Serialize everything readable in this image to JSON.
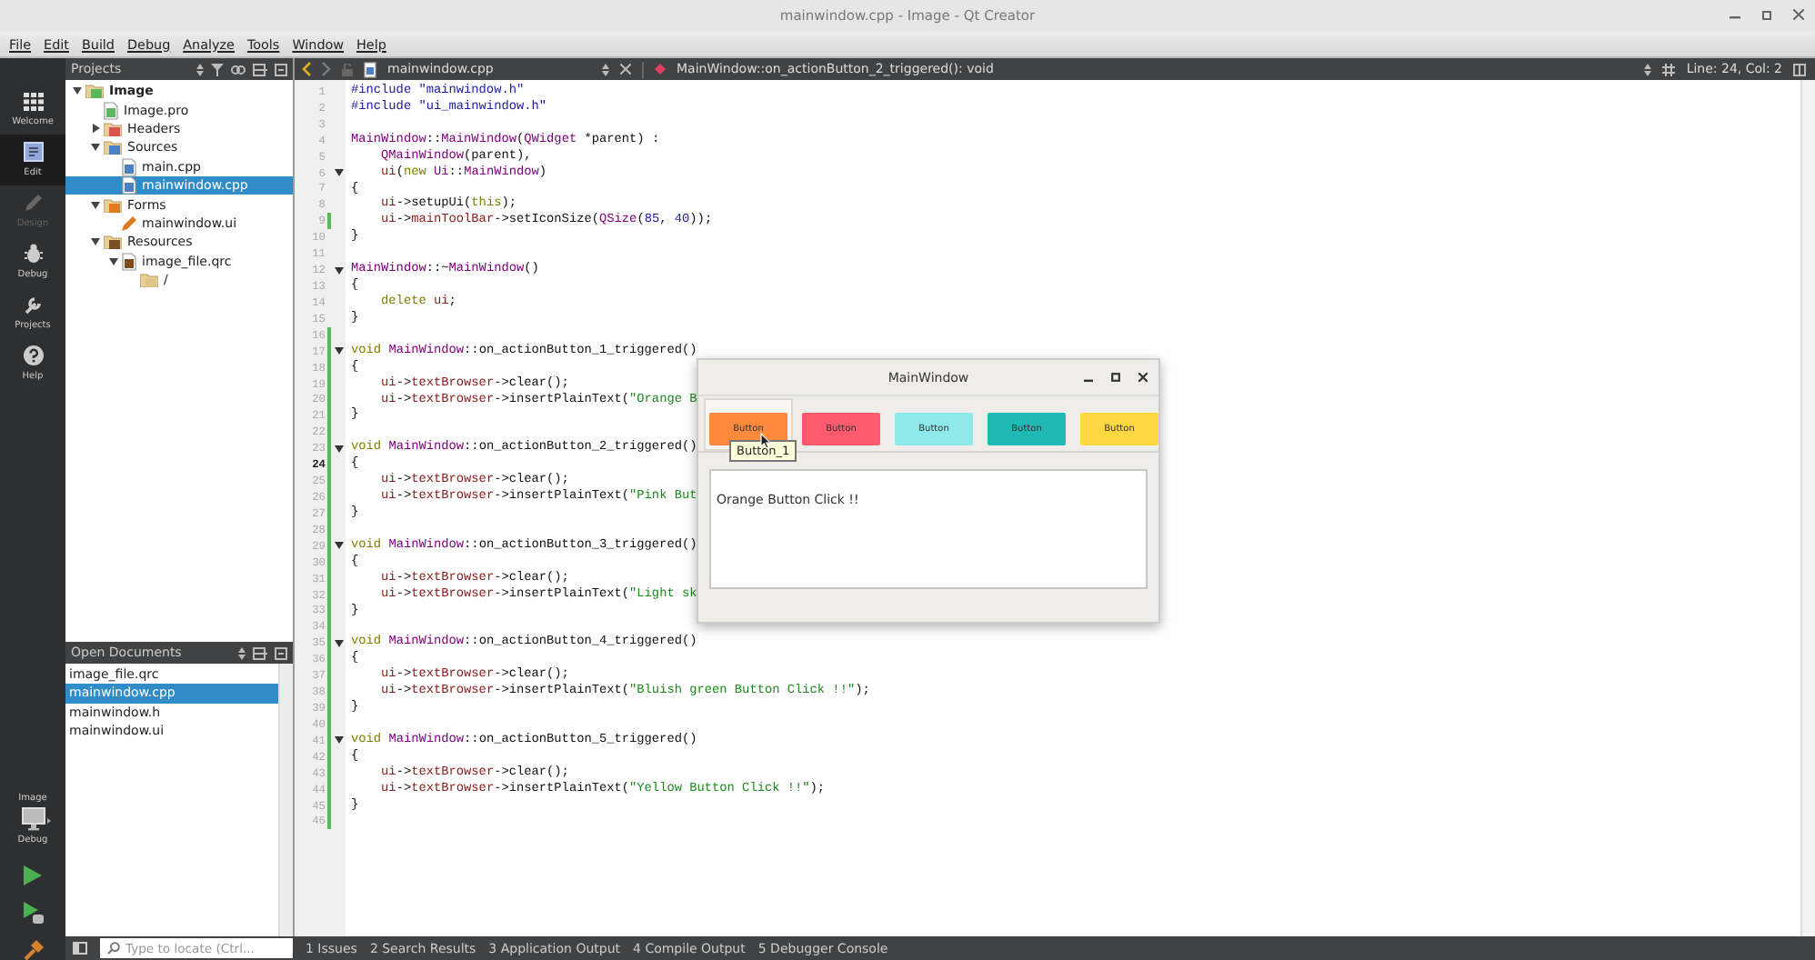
{
  "window": {
    "title": "mainwindow.cpp - Image - Qt Creator"
  },
  "menu": [
    "File",
    "Edit",
    "Build",
    "Debug",
    "Analyze",
    "Tools",
    "Window",
    "Help"
  ],
  "mode_bar": {
    "modes": [
      {
        "label": "Welcome",
        "selected": false,
        "disabled": false
      },
      {
        "label": "Edit",
        "selected": true,
        "disabled": false
      },
      {
        "label": "Design",
        "selected": false,
        "disabled": true
      },
      {
        "label": "Debug",
        "selected": false,
        "disabled": false
      },
      {
        "label": "Projects",
        "selected": false,
        "disabled": false
      },
      {
        "label": "Help",
        "selected": false,
        "disabled": false
      }
    ],
    "target": {
      "project": "Image",
      "config": "Debug"
    }
  },
  "projects_pane": {
    "title": "Projects",
    "tree": [
      {
        "label": "Image",
        "kind": "project",
        "color": "#5cb85c",
        "expanded": true,
        "selected": false,
        "children": [
          {
            "label": "Image.pro",
            "kind": "file",
            "color": "#5cb85c",
            "selected": false
          },
          {
            "label": "Headers",
            "kind": "folder",
            "color": "#d9534f",
            "expanded": false,
            "selected": false
          },
          {
            "label": "Sources",
            "kind": "folder",
            "color": "#4a7fc1",
            "expanded": true,
            "selected": false,
            "children": [
              {
                "label": "main.cpp",
                "kind": "file",
                "color": "#4a7fc1",
                "selected": false
              },
              {
                "label": "mainwindow.cpp",
                "kind": "file",
                "color": "#4a7fc1",
                "selected": true
              }
            ]
          },
          {
            "label": "Forms",
            "kind": "folder",
            "color": "#e07a1f",
            "expanded": true,
            "selected": false,
            "children": [
              {
                "label": "mainwindow.ui",
                "kind": "form",
                "color": "#e07a1f",
                "selected": false
              }
            ]
          },
          {
            "label": "Resources",
            "kind": "folder",
            "color": "#7a4e22",
            "expanded": true,
            "selected": false,
            "children": [
              {
                "label": "image_file.qrc",
                "kind": "file",
                "color": "#7a4e22",
                "expanded": true,
                "selected": false,
                "children": [
                  {
                    "label": "/",
                    "kind": "folder",
                    "color": "#e0c48a",
                    "selected": false
                  }
                ]
              }
            ]
          }
        ]
      }
    ]
  },
  "open_documents": {
    "title": "Open Documents",
    "items": [
      {
        "label": "image_file.qrc",
        "selected": false
      },
      {
        "label": "mainwindow.cpp",
        "selected": true
      },
      {
        "label": "mainwindow.h",
        "selected": false
      },
      {
        "label": "mainwindow.ui",
        "selected": false
      }
    ]
  },
  "editor": {
    "file": "mainwindow.cpp",
    "symbol": "MainWindow::on_actionButton_2_triggered(): void",
    "position": "Line: 24, Col: 2",
    "lines": [
      {
        "number": "1",
        "changed": false,
        "foldable": false,
        "current": false,
        "segments": [
          {
            "text": "#include \"mainwindow.h\"",
            "kind": "pp"
          }
        ]
      },
      {
        "number": "2",
        "changed": false,
        "foldable": false,
        "current": false,
        "segments": [
          {
            "text": "#include \"ui_mainwindow.h\"",
            "kind": "pp"
          }
        ]
      },
      {
        "number": "3",
        "changed": false,
        "foldable": false,
        "current": false
      },
      {
        "number": "4",
        "changed": false,
        "foldable": false,
        "current": false,
        "segments": [
          {
            "text": "MainWindow",
            "kind": "type"
          },
          {
            "text": "::",
            "kind": "plain"
          },
          {
            "text": "MainWindow",
            "kind": "type"
          },
          {
            "text": "(",
            "kind": "plain"
          },
          {
            "text": "QWidget",
            "kind": "type"
          },
          {
            "text": " *parent) :",
            "kind": "plain"
          }
        ]
      },
      {
        "number": "5",
        "changed": false,
        "foldable": false,
        "current": false,
        "segments": [
          {
            "text": "    QMainWindow",
            "kind": "type"
          },
          {
            "text": "(parent),",
            "kind": "plain"
          }
        ]
      },
      {
        "number": "6",
        "changed": false,
        "foldable": true,
        "current": false,
        "segments": [
          {
            "text": "    ui",
            "kind": "field"
          },
          {
            "text": "(",
            "kind": "plain"
          },
          {
            "text": "new ",
            "kind": "keyword"
          },
          {
            "text": "Ui",
            "kind": "type"
          },
          {
            "text": "::",
            "kind": "plain"
          },
          {
            "text": "MainWindow",
            "kind": "type"
          },
          {
            "text": ")",
            "kind": "plain"
          }
        ]
      },
      {
        "number": "7",
        "changed": false,
        "foldable": false,
        "current": false,
        "segments": [
          {
            "text": "{",
            "kind": "plain"
          }
        ]
      },
      {
        "number": "8",
        "changed": false,
        "foldable": false,
        "current": false,
        "segments": [
          {
            "text": "    ui",
            "kind": "field"
          },
          {
            "text": "->setupUi(",
            "kind": "plain"
          },
          {
            "text": "this",
            "kind": "keyword"
          },
          {
            "text": ");",
            "kind": "plain"
          }
        ]
      },
      {
        "number": "9",
        "changed": true,
        "foldable": false,
        "current": false,
        "segments": [
          {
            "text": "    ui",
            "kind": "field"
          },
          {
            "text": "->",
            "kind": "plain"
          },
          {
            "text": "mainToolBar",
            "kind": "field"
          },
          {
            "text": "->setIconSize(",
            "kind": "plain"
          },
          {
            "text": "QSize",
            "kind": "type"
          },
          {
            "text": "(",
            "kind": "plain"
          },
          {
            "text": "85",
            "kind": "number"
          },
          {
            "text": ", ",
            "kind": "plain"
          },
          {
            "text": "40",
            "kind": "number"
          },
          {
            "text": "));",
            "kind": "plain"
          }
        ]
      },
      {
        "number": "10",
        "changed": false,
        "foldable": false,
        "current": false,
        "segments": [
          {
            "text": "}",
            "kind": "plain"
          }
        ]
      },
      {
        "number": "11",
        "changed": false,
        "foldable": false,
        "current": false
      },
      {
        "number": "12",
        "changed": false,
        "foldable": true,
        "current": false,
        "segments": [
          {
            "text": "MainWindow",
            "kind": "type"
          },
          {
            "text": "::~",
            "kind": "plain"
          },
          {
            "text": "MainWindow",
            "kind": "type"
          },
          {
            "text": "()",
            "kind": "plain"
          }
        ]
      },
      {
        "number": "13",
        "changed": false,
        "foldable": false,
        "current": false,
        "segments": [
          {
            "text": "{",
            "kind": "plain"
          }
        ]
      },
      {
        "number": "14",
        "changed": false,
        "foldable": false,
        "current": false,
        "segments": [
          {
            "text": "    delete ",
            "kind": "keyword"
          },
          {
            "text": "ui",
            "kind": "field"
          },
          {
            "text": ";",
            "kind": "plain"
          }
        ]
      },
      {
        "number": "15",
        "changed": false,
        "foldable": false,
        "current": false,
        "segments": [
          {
            "text": "}",
            "kind": "plain"
          }
        ]
      },
      {
        "number": "16",
        "changed": true,
        "foldable": false,
        "current": false
      },
      {
        "number": "17",
        "changed": true,
        "foldable": true,
        "current": false,
        "segments": [
          {
            "text": "void ",
            "kind": "keyword"
          },
          {
            "text": "MainWindow",
            "kind": "type"
          },
          {
            "text": "::on_actionButton_1_triggered()",
            "kind": "plain"
          }
        ]
      },
      {
        "number": "18",
        "changed": true,
        "foldable": false,
        "current": false,
        "segments": [
          {
            "text": "{",
            "kind": "plain"
          }
        ]
      },
      {
        "number": "19",
        "changed": true,
        "foldable": false,
        "current": false,
        "segments": [
          {
            "text": "    ui",
            "kind": "field"
          },
          {
            "text": "->",
            "kind": "plain"
          },
          {
            "text": "textBrowser",
            "kind": "field"
          },
          {
            "text": "->clear();",
            "kind": "plain"
          }
        ]
      },
      {
        "number": "20",
        "changed": true,
        "foldable": false,
        "current": false,
        "segments": [
          {
            "text": "    ui",
            "kind": "field"
          },
          {
            "text": "->",
            "kind": "plain"
          },
          {
            "text": "textBrowser",
            "kind": "field"
          },
          {
            "text": "->insertPlainText(",
            "kind": "plain"
          },
          {
            "text": "\"Orange B",
            "kind": "string"
          }
        ]
      },
      {
        "number": "21",
        "changed": true,
        "foldable": false,
        "current": false,
        "segments": [
          {
            "text": "}",
            "kind": "plain"
          }
        ]
      },
      {
        "number": "22",
        "changed": true,
        "foldable": false,
        "current": false
      },
      {
        "number": "23",
        "changed": true,
        "foldable": true,
        "current": false,
        "segments": [
          {
            "text": "void ",
            "kind": "keyword"
          },
          {
            "text": "MainWindow",
            "kind": "type"
          },
          {
            "text": "::on_actionButton_2_triggered()",
            "kind": "plain"
          }
        ]
      },
      {
        "number": "24",
        "changed": true,
        "foldable": false,
        "current": true,
        "segments": [
          {
            "text": "{",
            "kind": "plain"
          }
        ]
      },
      {
        "number": "25",
        "changed": true,
        "foldable": false,
        "current": false,
        "segments": [
          {
            "text": "    ui",
            "kind": "field"
          },
          {
            "text": "->",
            "kind": "plain"
          },
          {
            "text": "textBrowser",
            "kind": "field"
          },
          {
            "text": "->clear();",
            "kind": "plain"
          }
        ]
      },
      {
        "number": "26",
        "changed": true,
        "foldable": false,
        "current": false,
        "segments": [
          {
            "text": "    ui",
            "kind": "field"
          },
          {
            "text": "->",
            "kind": "plain"
          },
          {
            "text": "textBrowser",
            "kind": "field"
          },
          {
            "text": "->insertPlainText(",
            "kind": "plain"
          },
          {
            "text": "\"Pink But",
            "kind": "string"
          }
        ]
      },
      {
        "number": "27",
        "changed": true,
        "foldable": false,
        "current": false,
        "segments": [
          {
            "text": "}",
            "kind": "plain"
          }
        ]
      },
      {
        "number": "28",
        "changed": true,
        "foldable": false,
        "current": false
      },
      {
        "number": "29",
        "changed": true,
        "foldable": true,
        "current": false,
        "segments": [
          {
            "text": "void ",
            "kind": "keyword"
          },
          {
            "text": "MainWindow",
            "kind": "type"
          },
          {
            "text": "::on_actionButton_3_triggered()",
            "kind": "plain"
          }
        ]
      },
      {
        "number": "30",
        "changed": true,
        "foldable": false,
        "current": false,
        "segments": [
          {
            "text": "{",
            "kind": "plain"
          }
        ]
      },
      {
        "number": "31",
        "changed": true,
        "foldable": false,
        "current": false,
        "segments": [
          {
            "text": "    ui",
            "kind": "field"
          },
          {
            "text": "->",
            "kind": "plain"
          },
          {
            "text": "textBrowser",
            "kind": "field"
          },
          {
            "text": "->clear();",
            "kind": "plain"
          }
        ]
      },
      {
        "number": "32",
        "changed": true,
        "foldable": false,
        "current": false,
        "segments": [
          {
            "text": "    ui",
            "kind": "field"
          },
          {
            "text": "->",
            "kind": "plain"
          },
          {
            "text": "textBrowser",
            "kind": "field"
          },
          {
            "text": "->insertPlainText(",
            "kind": "plain"
          },
          {
            "text": "\"Light sk",
            "kind": "string"
          }
        ]
      },
      {
        "number": "33",
        "changed": true,
        "foldable": false,
        "current": false,
        "segments": [
          {
            "text": "}",
            "kind": "plain"
          }
        ]
      },
      {
        "number": "34",
        "changed": true,
        "foldable": false,
        "current": false
      },
      {
        "number": "35",
        "changed": true,
        "foldable": true,
        "current": false,
        "segments": [
          {
            "text": "void ",
            "kind": "keyword"
          },
          {
            "text": "MainWindow",
            "kind": "type"
          },
          {
            "text": "::on_actionButton_4_triggered()",
            "kind": "plain"
          }
        ]
      },
      {
        "number": "36",
        "changed": true,
        "foldable": false,
        "current": false,
        "segments": [
          {
            "text": "{",
            "kind": "plain"
          }
        ]
      },
      {
        "number": "37",
        "changed": true,
        "foldable": false,
        "current": false,
        "segments": [
          {
            "text": "    ui",
            "kind": "field"
          },
          {
            "text": "->",
            "kind": "plain"
          },
          {
            "text": "textBrowser",
            "kind": "field"
          },
          {
            "text": "->clear();",
            "kind": "plain"
          }
        ]
      },
      {
        "number": "38",
        "changed": true,
        "foldable": false,
        "current": false,
        "segments": [
          {
            "text": "    ui",
            "kind": "field"
          },
          {
            "text": "->",
            "kind": "plain"
          },
          {
            "text": "textBrowser",
            "kind": "field"
          },
          {
            "text": "->insertPlainText(",
            "kind": "plain"
          },
          {
            "text": "\"Bluish green Button Click !!\"",
            "kind": "string"
          },
          {
            "text": ");",
            "kind": "plain"
          }
        ]
      },
      {
        "number": "39",
        "changed": true,
        "foldable": false,
        "current": false,
        "segments": [
          {
            "text": "}",
            "kind": "plain"
          }
        ]
      },
      {
        "number": "40",
        "changed": true,
        "foldable": false,
        "current": false
      },
      {
        "number": "41",
        "changed": true,
        "foldable": true,
        "current": false,
        "segments": [
          {
            "text": "void ",
            "kind": "keyword"
          },
          {
            "text": "MainWindow",
            "kind": "type"
          },
          {
            "text": "::on_actionButton_5_triggered()",
            "kind": "plain"
          }
        ]
      },
      {
        "number": "42",
        "changed": true,
        "foldable": false,
        "current": false,
        "segments": [
          {
            "text": "{",
            "kind": "plain"
          }
        ]
      },
      {
        "number": "43",
        "changed": true,
        "foldable": false,
        "current": false,
        "segments": [
          {
            "text": "    ui",
            "kind": "field"
          },
          {
            "text": "->",
            "kind": "plain"
          },
          {
            "text": "textBrowser",
            "kind": "field"
          },
          {
            "text": "->clear();",
            "kind": "plain"
          }
        ]
      },
      {
        "number": "44",
        "changed": true,
        "foldable": false,
        "current": false,
        "segments": [
          {
            "text": "    ui",
            "kind": "field"
          },
          {
            "text": "->",
            "kind": "plain"
          },
          {
            "text": "textBrowser",
            "kind": "field"
          },
          {
            "text": "->insertPlainText(",
            "kind": "plain"
          },
          {
            "text": "\"Yellow Button Click !!\"",
            "kind": "string"
          },
          {
            "text": ");",
            "kind": "plain"
          }
        ]
      },
      {
        "number": "45",
        "changed": true,
        "foldable": false,
        "current": false,
        "segments": [
          {
            "text": "}",
            "kind": "plain"
          }
        ]
      },
      {
        "number": "46",
        "changed": true,
        "foldable": false,
        "current": false
      }
    ]
  },
  "app_window": {
    "title": "MainWindow",
    "buttons": [
      {
        "label": "Button",
        "color": "#ff8a3d",
        "hovered": true
      },
      {
        "label": "Button",
        "color": "#ff5a6e",
        "hovered": false
      },
      {
        "label": "Button",
        "color": "#8eeaea",
        "hovered": false
      },
      {
        "label": "Button",
        "color": "#20bab5",
        "hovered": false
      },
      {
        "label": "Button",
        "color": "#ffd740",
        "hovered": false
      }
    ],
    "tooltip": "Button_1",
    "output": "Orange Button Click !!"
  },
  "locator": {
    "placeholder": "Type to locate (Ctrl..."
  },
  "output_tabs": [
    "1 Issues",
    "2 Search Results",
    "3 Application Output",
    "4 Compile Output",
    "5 Debugger Console"
  ]
}
